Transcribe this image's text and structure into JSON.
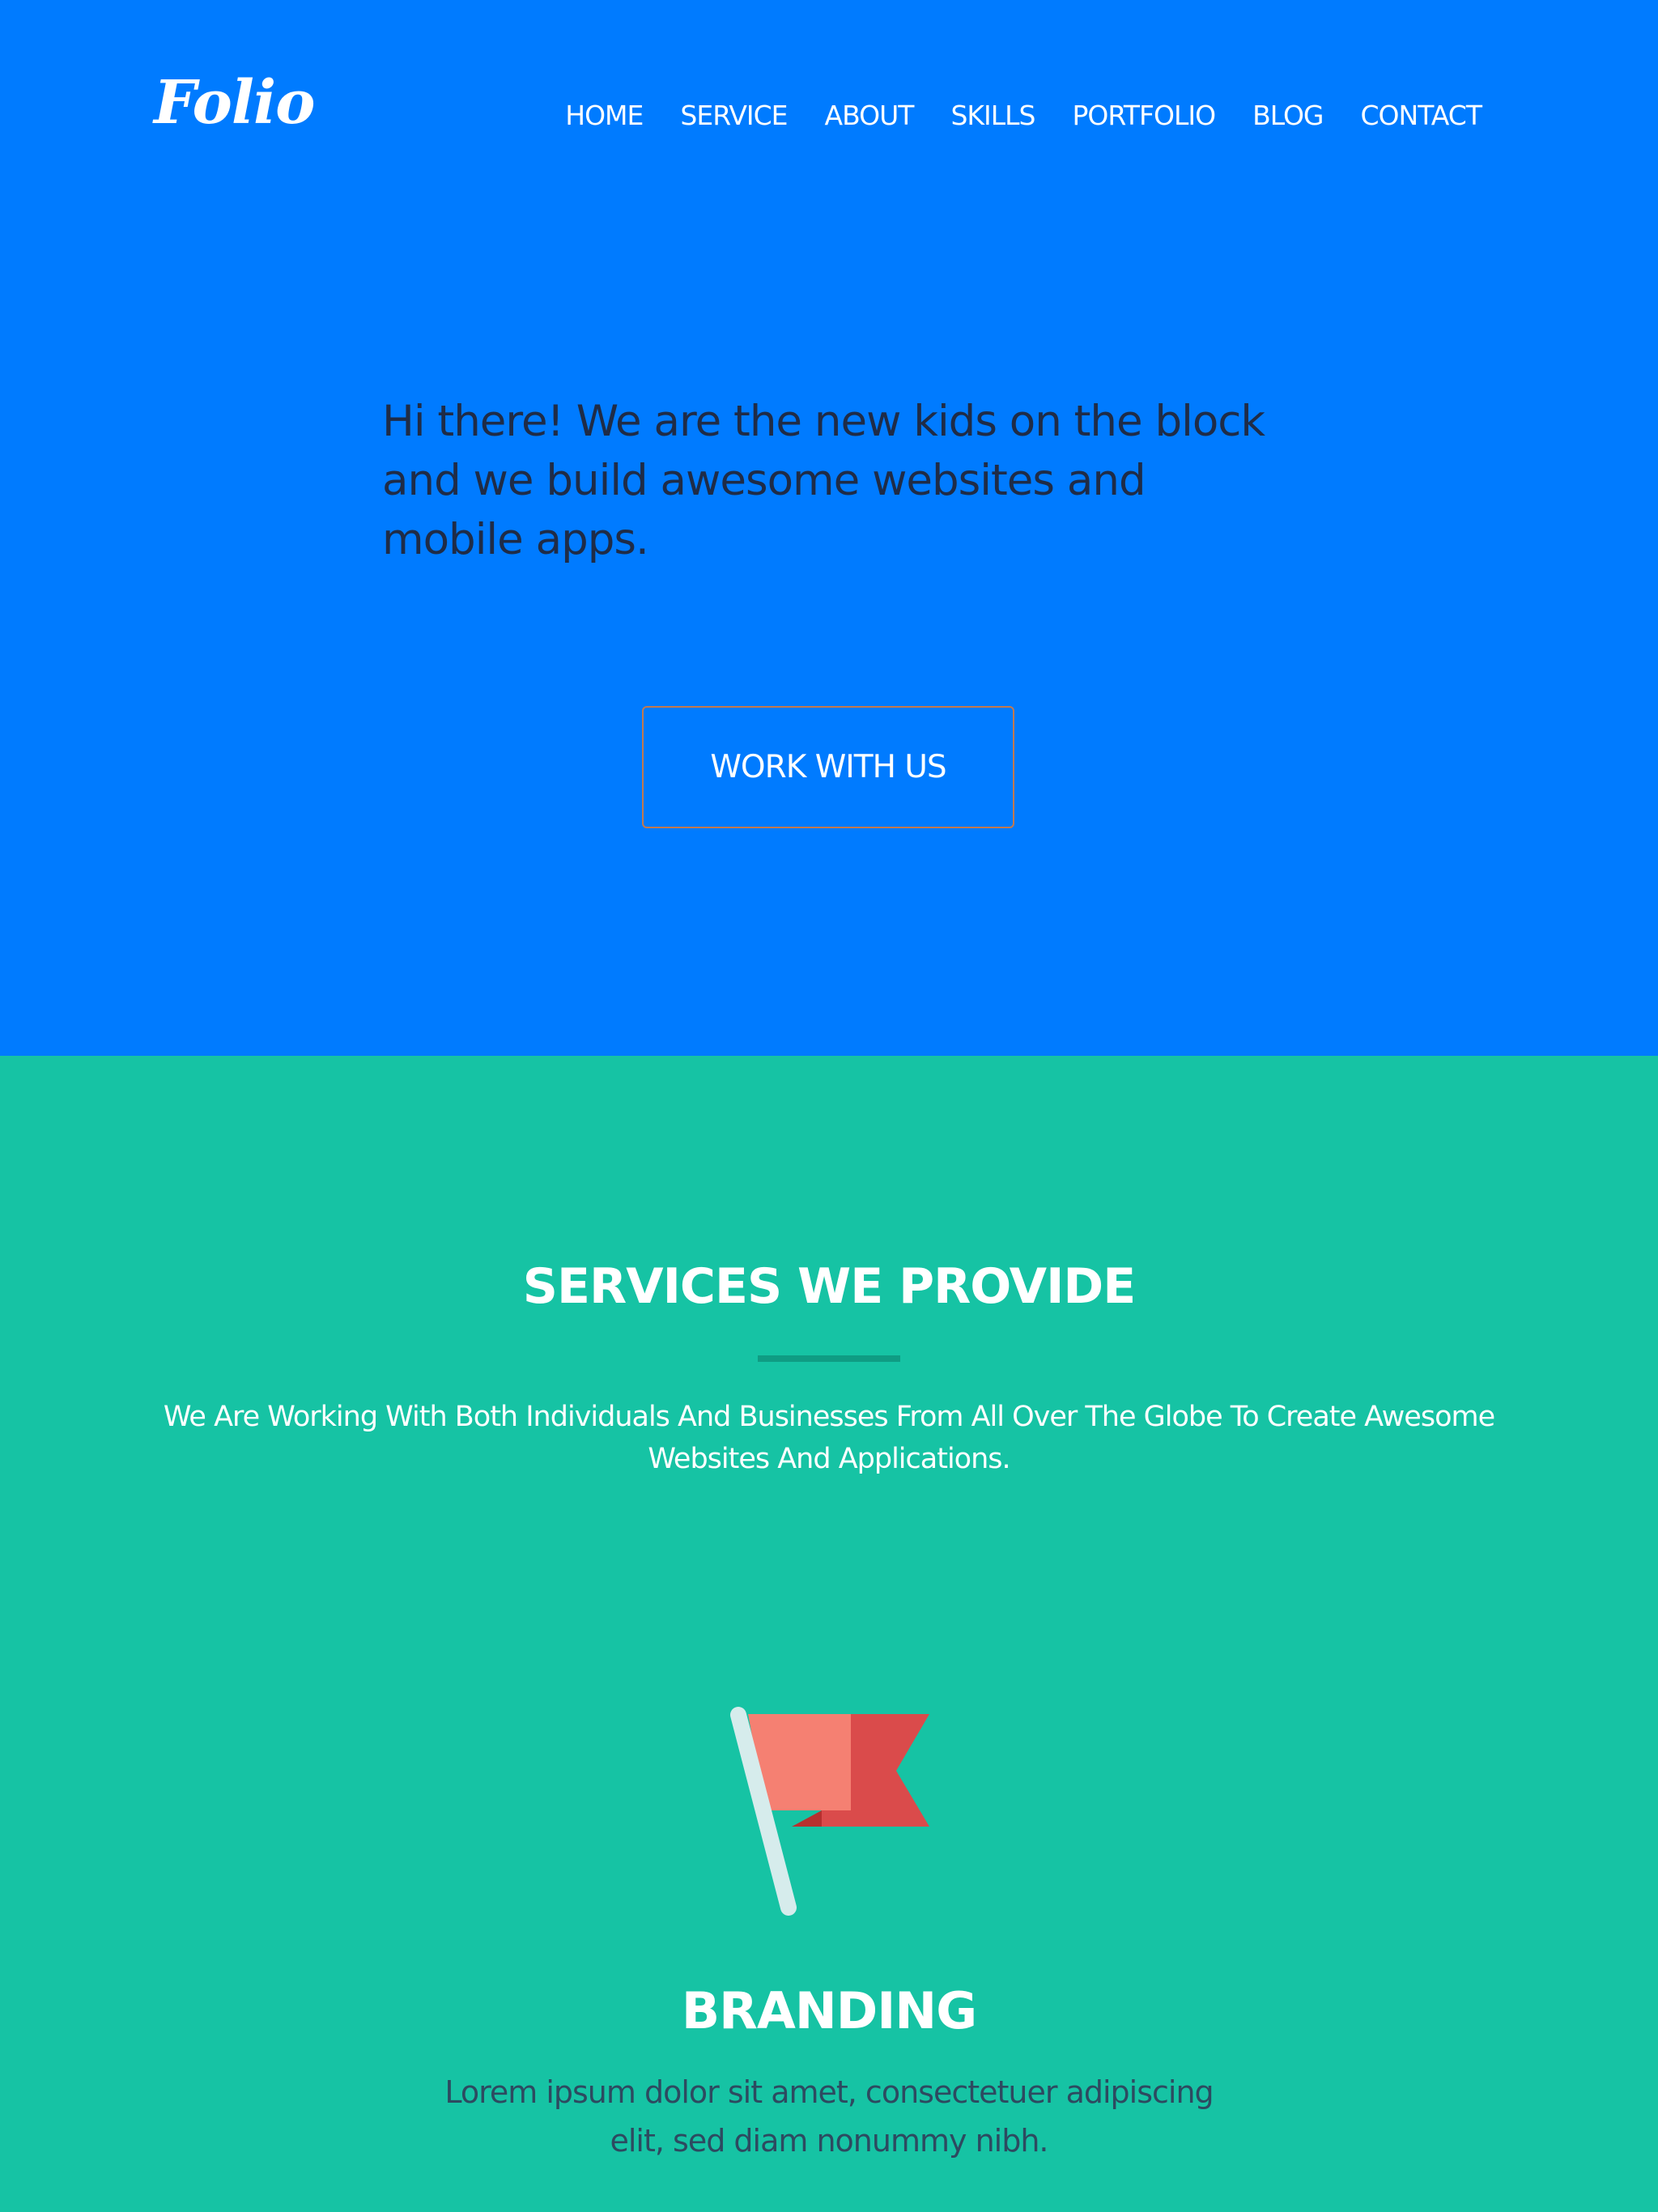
{
  "header": {
    "logo": "Folio",
    "nav": [
      {
        "label": "HOME"
      },
      {
        "label": "SERVICE"
      },
      {
        "label": "ABOUT"
      },
      {
        "label": "SKILLS"
      },
      {
        "label": "PORTFOLIO"
      },
      {
        "label": "BLOG"
      },
      {
        "label": "CONTACT"
      }
    ]
  },
  "hero": {
    "text": "Hi there! We are the new kids on the block and we build awesome websites and mobile apps.",
    "cta_label": "WORK WITH US"
  },
  "services": {
    "title": "SERVICES WE PROVIDE",
    "subtitle": "We Are Working With Both Individuals And Businesses From All Over The Globe To Create Awesome Websites And Applications.",
    "items": [
      {
        "icon": "flag-icon",
        "title": "BRANDING",
        "text": "Lorem ipsum dolor sit amet, consectetuer adipiscing elit, sed diam nonummy nibh."
      }
    ]
  },
  "colors": {
    "hero_bg": "#007bff",
    "services_bg": "#16c3a4",
    "divider": "#0f9c83",
    "hero_text": "#1f2c47",
    "service_text": "#2d4a60",
    "cta_border": "#c2794f"
  }
}
